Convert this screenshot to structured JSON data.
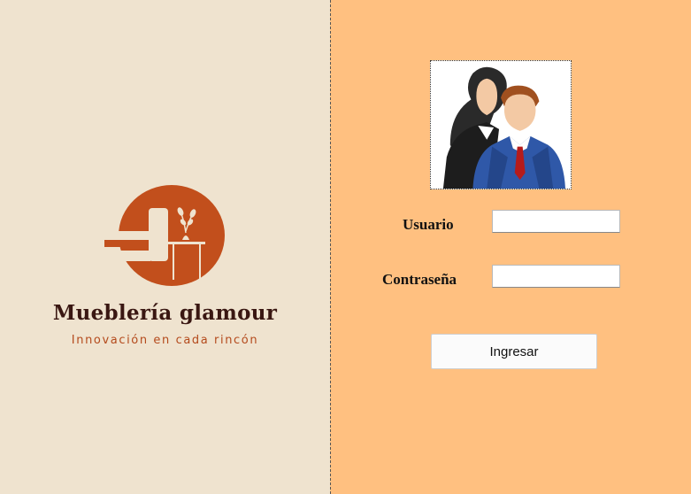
{
  "branding": {
    "name": "Mueblería glamour",
    "tagline": "Innovación en cada rincón",
    "logo_icon": "furniture-logo",
    "colors": {
      "accent": "#c24f1c",
      "name_text": "#3a1712",
      "left_bg": "#efe3cf"
    }
  },
  "login": {
    "avatar_icon": "users-avatar",
    "username_label": "Usuario",
    "username_value": "",
    "password_label": "Contraseña",
    "password_value": "",
    "submit_label": "Ingresar",
    "colors": {
      "panel_bg": "#ffc080"
    }
  }
}
